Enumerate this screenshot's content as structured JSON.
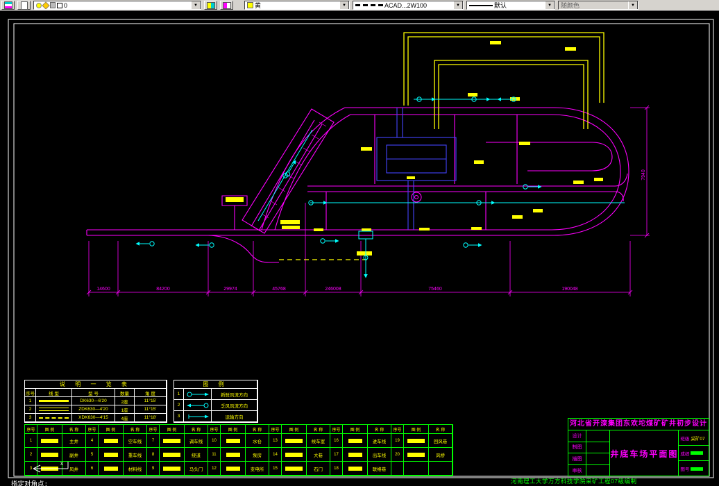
{
  "toolbar": {
    "layer": {
      "value": "0"
    },
    "color": {
      "value": "黄"
    },
    "linetype": {
      "value": "ACAD...2W100"
    },
    "lineweight": {
      "value": "默认"
    },
    "plot_style": {
      "value": "随颜色"
    }
  },
  "footer": {
    "command": "指定对角点:",
    "institution": "河南理工大学万方科技学院采矿工程07级编制"
  },
  "title_block": {
    "project": "河北省开滦集团东欢坨煤矿矿井初步设计",
    "drawing": "井底车场平面图",
    "roles": [
      "设计",
      "制图",
      "描图",
      "审核"
    ],
    "right": [
      {
        "label": "班级",
        "value": "采矿07"
      },
      {
        "label": "成绩",
        "value": ""
      },
      {
        "label": "图号",
        "value": ""
      }
    ]
  },
  "spec_table": {
    "title": "说 明 一 览 表",
    "headers": [
      "序号",
      "线 型",
      "型 号",
      "数量",
      "角 度"
    ],
    "rows": [
      {
        "num": "1",
        "model": "DK630—6′20",
        "qty": "2座",
        "angle": "11°15′"
      },
      {
        "num": "2",
        "model": "ZDK630—4′20",
        "qty": "1座",
        "angle": "11°15′"
      },
      {
        "num": "3",
        "model": "XDK630—4′15",
        "qty": "4座",
        "angle": "11°18′"
      }
    ]
  },
  "legend_table": {
    "title": "图 例",
    "rows": [
      {
        "num": "1",
        "desc": "新鲜风流方向"
      },
      {
        "num": "2",
        "desc": "乏风风流方向"
      },
      {
        "num": "3",
        "desc": "运输方向"
      }
    ]
  },
  "main_table": {
    "headers": [
      "序号",
      "图 例",
      "名 称"
    ],
    "entries": [
      {
        "num": "1",
        "name": "主井"
      },
      {
        "num": "2",
        "name": "副井"
      },
      {
        "num": "3",
        "name": "风井"
      },
      {
        "num": "4",
        "name": "空车线"
      },
      {
        "num": "5",
        "name": "重车线"
      },
      {
        "num": "6",
        "name": "材料线"
      },
      {
        "num": "7",
        "name": "调车线"
      },
      {
        "num": "8",
        "name": "绕道"
      },
      {
        "num": "9",
        "name": "马头门"
      },
      {
        "num": "10",
        "name": "水仓"
      },
      {
        "num": "11",
        "name": "泵房"
      },
      {
        "num": "12",
        "name": "变电所"
      },
      {
        "num": "13",
        "name": "候车室"
      },
      {
        "num": "14",
        "name": "大巷"
      },
      {
        "num": "15",
        "name": "石门"
      },
      {
        "num": "16",
        "name": "进车线"
      },
      {
        "num": "17",
        "name": "出车线"
      },
      {
        "num": "18",
        "name": "联络巷"
      },
      {
        "num": "19",
        "name": "回风巷"
      },
      {
        "num": "20",
        "name": "风桥"
      }
    ]
  },
  "drawing": {
    "dims_bottom": [
      "14600",
      "84200",
      "29974",
      "45768",
      "246008",
      "75460",
      "190048"
    ],
    "dim_right": "7940"
  },
  "colors": {
    "canvas": "#000000",
    "magenta": "#ff00ff",
    "cyan": "#00ffff",
    "yellow": "#ffff00",
    "green": "#00ff00",
    "blue": "#4444ff",
    "frame": "#ffffff",
    "toolbar_bg": "#d6d3ce"
  }
}
